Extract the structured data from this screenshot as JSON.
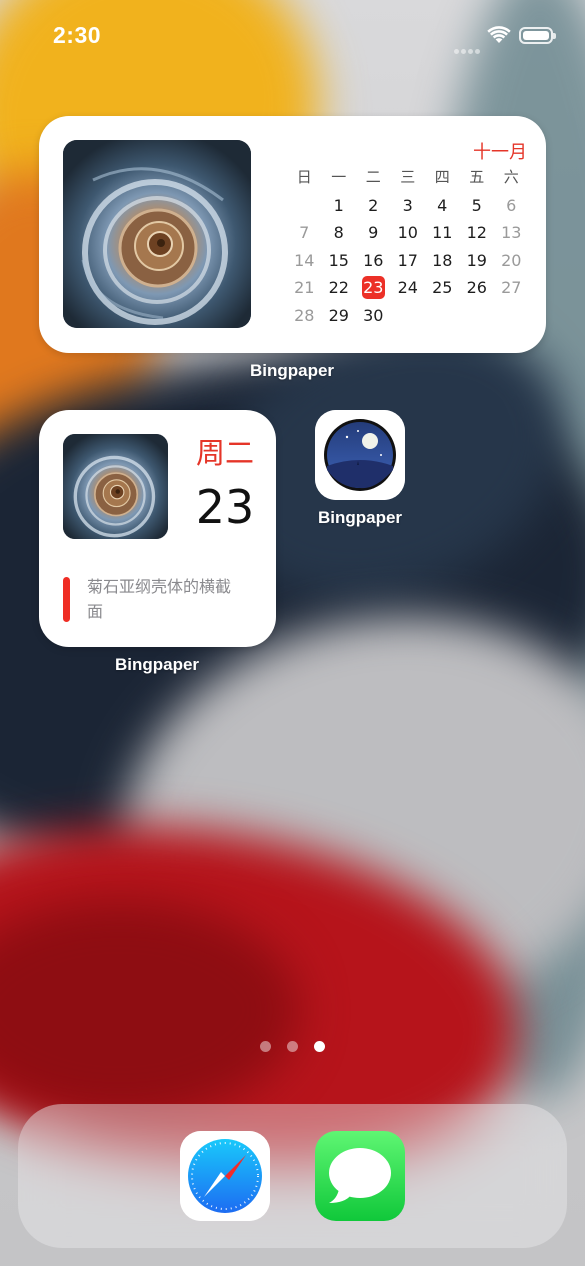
{
  "status_bar": {
    "time": "2:30",
    "icons": [
      "cellular-signal-icon",
      "wifi-icon",
      "battery-icon"
    ]
  },
  "widget_large": {
    "image": "ammonite-shell-photo",
    "month": "十一月",
    "weekdays": [
      "日",
      "一",
      "二",
      "三",
      "四",
      "五",
      "六"
    ],
    "weeks": [
      [
        "",
        "",
        "1",
        "2",
        "3",
        "4",
        "5",
        "6"
      ],
      [
        "7",
        "8",
        "9",
        "10",
        "11",
        "12",
        "13"
      ],
      [
        "14",
        "15",
        "16",
        "17",
        "18",
        "19",
        "20"
      ],
      [
        "21",
        "22",
        "23",
        "24",
        "25",
        "26",
        "27"
      ],
      [
        "28",
        "29",
        "30"
      ]
    ],
    "today": "23",
    "label": "Bingpaper"
  },
  "widget_small": {
    "image": "ammonite-shell-photo",
    "weekday": "周二",
    "day": "23",
    "caption": "菊石亚纲壳体的横截面",
    "label": "Bingpaper"
  },
  "apps": [
    {
      "name": "Bingpaper",
      "icon": "moon-night-icon"
    }
  ],
  "page_dots": {
    "count": 3,
    "active_index": 2
  },
  "dock": {
    "apps": [
      {
        "name": "Safari",
        "icon": "safari-compass-icon"
      },
      {
        "name": "Messages",
        "icon": "messages-bubble-icon"
      }
    ]
  },
  "colors": {
    "accent_red": "#e53528",
    "dock_bg": "rgba(235,235,238,0.42)"
  }
}
